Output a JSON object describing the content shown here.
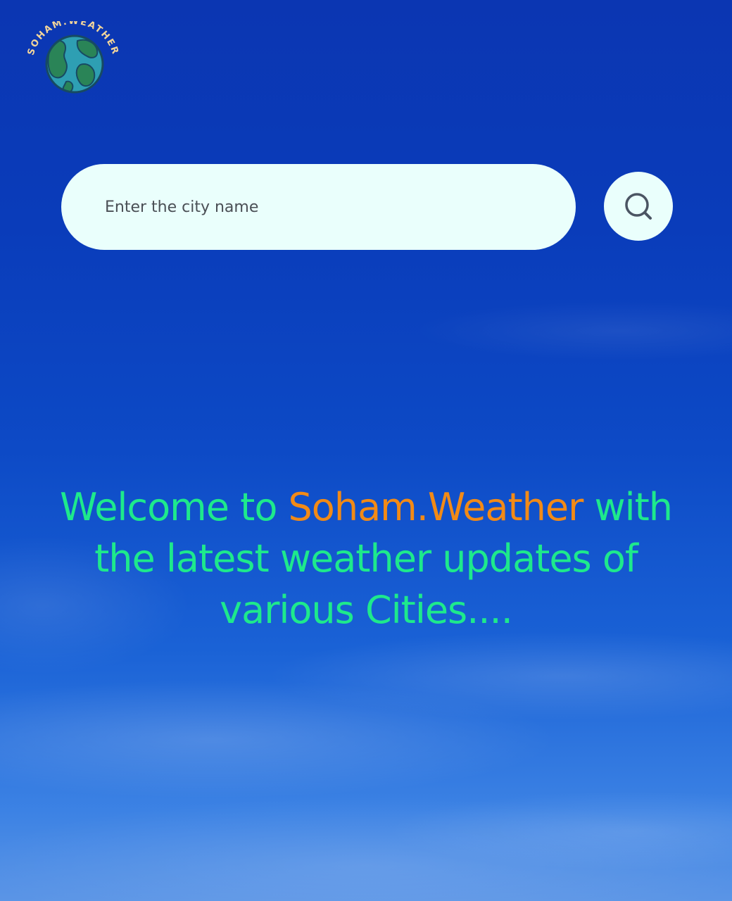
{
  "logo": {
    "text": "SOHAM.WEATHER",
    "icon": "globe-icon"
  },
  "search": {
    "placeholder": "Enter the city name",
    "value": "",
    "button_icon": "search-icon"
  },
  "welcome": {
    "prefix": "Welcome to ",
    "brand": "Soham.Weather",
    "suffix": " with the latest weather updates of various Cities...."
  },
  "colors": {
    "welcome_text": "#1ee98c",
    "brand_text": "#f28a16",
    "search_background": "#eafffc",
    "sky_top": "#0b36b2",
    "sky_bottom": "#5b95e6"
  }
}
